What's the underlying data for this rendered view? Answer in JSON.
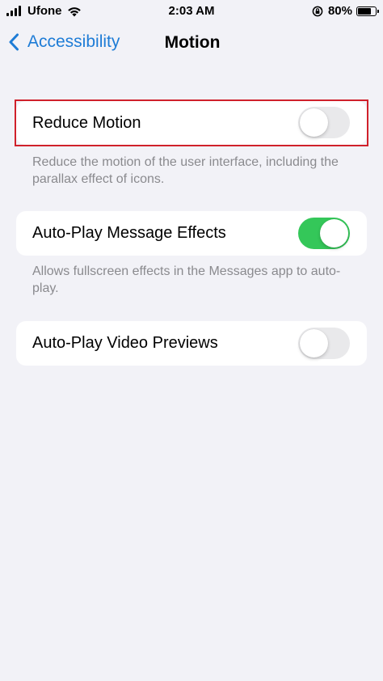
{
  "status_bar": {
    "carrier": "Ufone",
    "time": "2:03 AM",
    "battery_percent_label": "80%",
    "battery_level": 0.8
  },
  "nav": {
    "back_label": "Accessibility",
    "title": "Motion"
  },
  "settings": {
    "reduce_motion": {
      "label": "Reduce Motion",
      "enabled": false,
      "footer": "Reduce the motion of the user interface, including the parallax effect of icons."
    },
    "auto_play_message_effects": {
      "label": "Auto-Play Message Effects",
      "enabled": true,
      "footer": "Allows fullscreen effects in the Messages app to auto-play."
    },
    "auto_play_video_previews": {
      "label": "Auto-Play Video Previews",
      "enabled": false
    }
  },
  "colors": {
    "accent": "#1e7cd6",
    "toggle_on": "#34c759",
    "toggle_off": "#e9e9eb",
    "highlight": "#d0212b",
    "background": "#f2f2f7"
  },
  "icons": [
    "cellular-signal-icon",
    "wifi-icon",
    "rotation-lock-icon",
    "battery-icon",
    "chevron-left-icon"
  ]
}
